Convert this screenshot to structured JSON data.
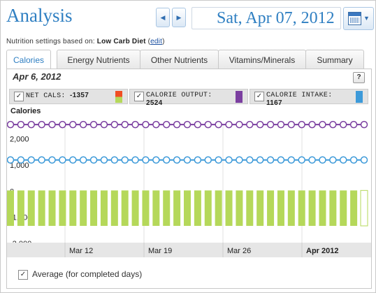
{
  "header": {
    "title": "Analysis",
    "date": "Sat, Apr 07, 2012"
  },
  "nav": {
    "prev_glyph": "◀",
    "next_glyph": "▶",
    "calendar_icon": "calendar-icon",
    "caret_glyph": "▼"
  },
  "settings": {
    "prefix": "Nutrition settings based on:",
    "diet": "Low Carb Diet",
    "edit_label": "edit"
  },
  "tabs": [
    {
      "label": "Calories",
      "active": true
    },
    {
      "label": "Energy Nutrients"
    },
    {
      "label": "Other Nutrients"
    },
    {
      "label": "Vitamins/Minerals"
    },
    {
      "label": "Summary"
    }
  ],
  "panel": {
    "date": "Apr 6, 2012",
    "help": "?",
    "chart_title": "Calories"
  },
  "legend": [
    {
      "name": "NET CALS:",
      "value": "-1357",
      "colors": [
        "#f04e23",
        "#b5d85a"
      ]
    },
    {
      "name": "CALORIE OUTPUT:",
      "value": "2524",
      "colors": [
        "#7b3fa0"
      ]
    },
    {
      "name": "CALORIE INTAKE:",
      "value": "1167",
      "colors": [
        "#3d9ad9"
      ]
    }
  ],
  "checkmark": "✓",
  "average": {
    "label": "Average (for completed days)"
  },
  "chart_data": {
    "type": "bar",
    "yticks": [
      2000,
      1000,
      0,
      -1000,
      -2000
    ],
    "ytick_labels": [
      "2,000",
      "1,000",
      "0",
      "-1,000",
      "-2,000"
    ],
    "ylim": [
      -2000,
      2500
    ],
    "xtick_labels": [
      "Mar 12",
      "Mar 19",
      "Mar 26",
      "Apr 2012"
    ],
    "series": [
      {
        "name": "CALORIE OUTPUT",
        "type": "line",
        "color": "#7b3fa0",
        "values": [
          2524,
          2524,
          2524,
          2524,
          2524,
          2524,
          2524,
          2524,
          2524,
          2524,
          2524,
          2524,
          2524,
          2524,
          2524,
          2524,
          2524,
          2524,
          2524,
          2524,
          2524,
          2524,
          2524,
          2524,
          2524,
          2524,
          2524,
          2524,
          2524,
          2524,
          2524,
          2524,
          2524,
          2524,
          2524
        ]
      },
      {
        "name": "CALORIE INTAKE",
        "type": "line",
        "color": "#3d9ad9",
        "values": [
          1167,
          1167,
          1167,
          1167,
          1167,
          1167,
          1167,
          1167,
          1167,
          1167,
          1167,
          1167,
          1167,
          1167,
          1167,
          1167,
          1167,
          1167,
          1167,
          1167,
          1167,
          1167,
          1167,
          1167,
          1167,
          1167,
          1167,
          1167,
          1167,
          1167,
          1167,
          1167,
          1167,
          1167,
          1167
        ]
      },
      {
        "name": "NET CALS",
        "type": "bar",
        "color": "#b5d85a",
        "values": [
          -1357,
          -1357,
          -1357,
          -1357,
          -1357,
          -1357,
          -1357,
          -1357,
          -1357,
          -1357,
          -1357,
          -1357,
          -1357,
          -1357,
          -1357,
          -1357,
          -1357,
          -1357,
          -1357,
          -1357,
          -1357,
          -1357,
          -1357,
          -1357,
          -1357,
          -1357,
          -1357,
          -1357,
          -1357,
          -1357,
          -1357,
          -1357,
          -1357,
          -1357,
          -1357
        ],
        "last_outline": true
      }
    ]
  }
}
